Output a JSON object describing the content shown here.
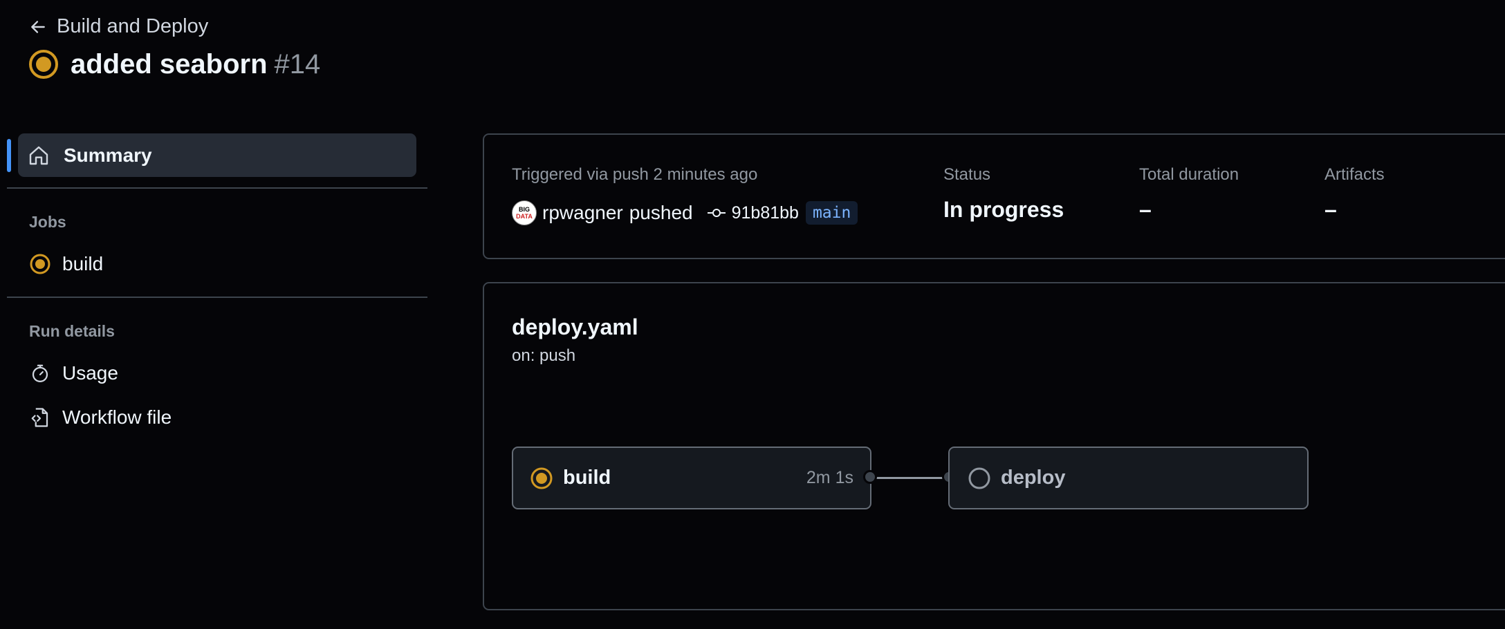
{
  "header": {
    "back_label": "Build and Deploy",
    "run_title": "added seaborn",
    "run_number": "#14"
  },
  "sidebar": {
    "summary_label": "Summary",
    "jobs_heading": "Jobs",
    "jobs": [
      {
        "label": "build",
        "status": "in-progress"
      }
    ],
    "run_details_heading": "Run details",
    "run_details": [
      {
        "label": "Usage",
        "icon": "stopwatch-icon"
      },
      {
        "label": "Workflow file",
        "icon": "file-code-icon"
      }
    ]
  },
  "summary": {
    "trigger_text": "Triggered via push 2 minutes ago",
    "actor": "rpwagner",
    "action": "pushed",
    "avatar_text_line1": "BIG",
    "avatar_text_line2": "DATA",
    "commit_sha": "91b81bb",
    "branch": "main",
    "status_label": "Status",
    "status_value": "In progress",
    "duration_label": "Total duration",
    "duration_value": "–",
    "artifacts_label": "Artifacts",
    "artifacts_value": "–"
  },
  "workflow": {
    "file_name": "deploy.yaml",
    "trigger": "on: push",
    "jobs": [
      {
        "name": "build",
        "duration": "2m 1s",
        "status": "in-progress"
      },
      {
        "name": "deploy",
        "duration": "",
        "status": "queued"
      }
    ]
  },
  "colors": {
    "background": "#050508",
    "in_progress": "#d29922",
    "accent_blue": "#4493f8",
    "border": "#3d444d"
  }
}
